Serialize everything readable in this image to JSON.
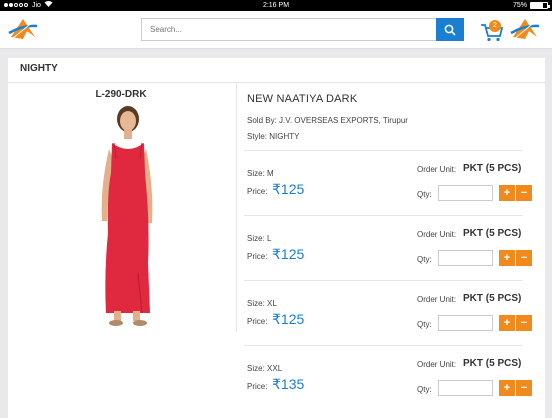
{
  "status_bar": {
    "carrier": "Jio",
    "time": "2:16 PM",
    "battery": "75%",
    "battery_level": 0.75
  },
  "header": {
    "search_placeholder": "Search...",
    "cart_count": "2"
  },
  "category": "NIGHTY",
  "product": {
    "sku": "L-290-DRK",
    "name": "NEW NAATIYA DARK",
    "sold_by_label": "Sold By:",
    "sold_by": "J.V. OVERSEAS EXPORTS, Tirupur",
    "style_label": "Style:",
    "style": "NIGHTY"
  },
  "labels": {
    "size": "Size:",
    "price": "Price:",
    "order_unit": "Order Unit:",
    "qty": "Qty:",
    "plus": "+",
    "minus": "−",
    "currency": "₹"
  },
  "variants": [
    {
      "size": "M",
      "price": "125",
      "unit": "PKT (5 PCS)"
    },
    {
      "size": "L",
      "price": "125",
      "unit": "PKT (5 PCS)"
    },
    {
      "size": "XL",
      "price": "125",
      "unit": "PKT (5 PCS)"
    },
    {
      "size": "XXL",
      "price": "135",
      "unit": "PKT (5 PCS)"
    }
  ],
  "colors": {
    "accent": "#1a7fd1",
    "orange": "#f08a1c",
    "dress": "#e0283f"
  }
}
